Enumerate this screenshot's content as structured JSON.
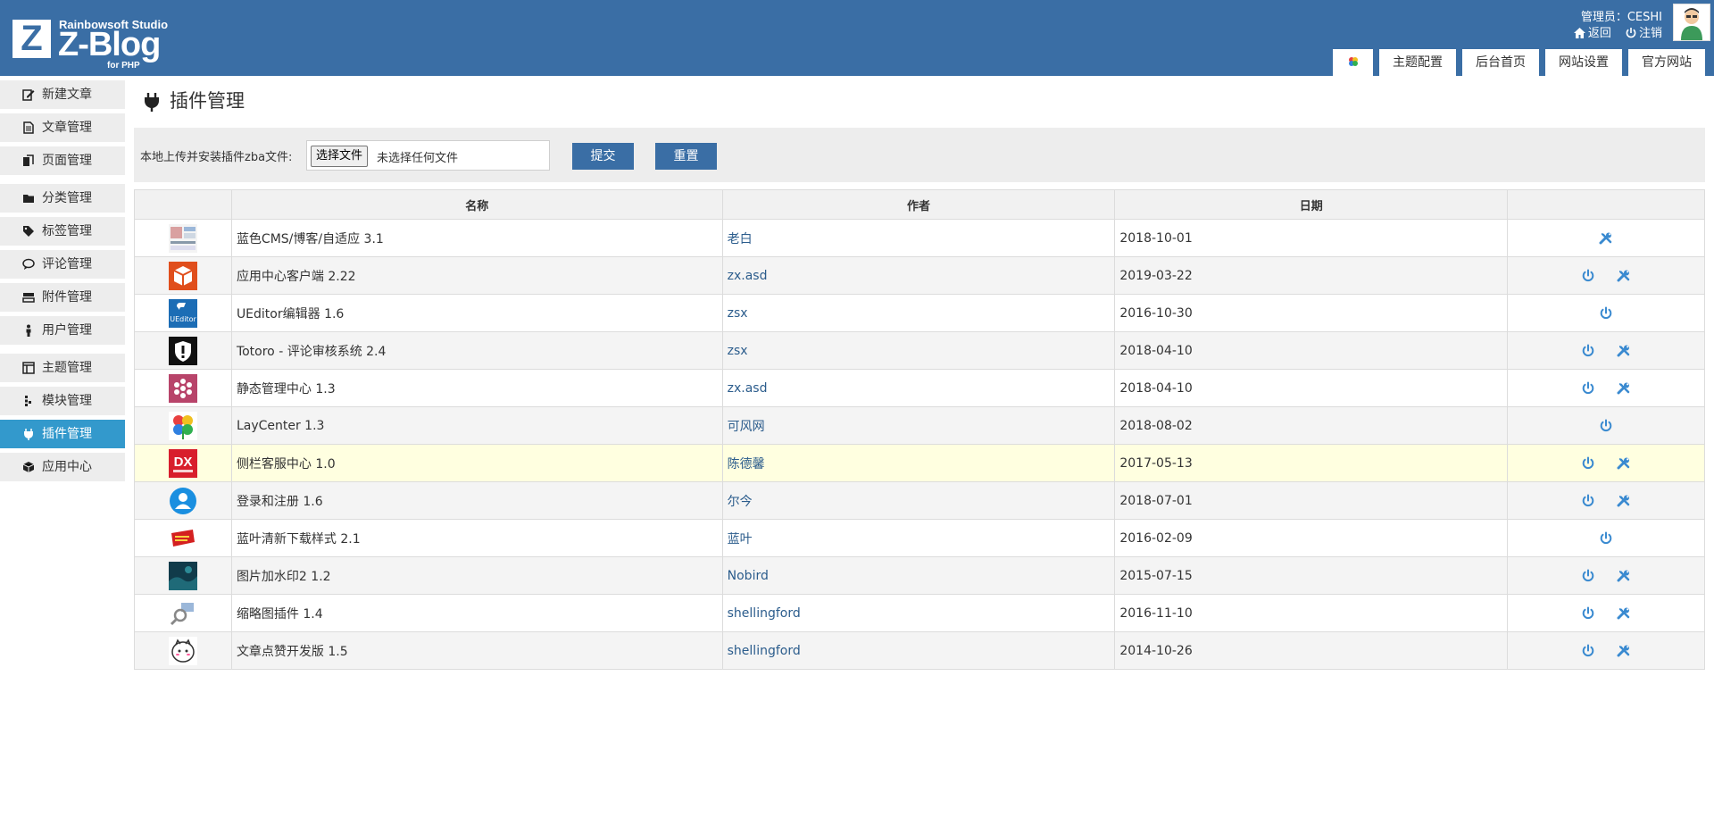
{
  "header": {
    "logo_box": "Z",
    "logo_studio": "Rainbowsoft Studio",
    "logo_name": "Z-Blog",
    "logo_sub": "for PHP",
    "admin_text": "管理员：CESHI",
    "back_label": "返回",
    "logout_label": "注销",
    "tabs": [
      "主题配置",
      "后台首页",
      "网站设置",
      "官方网站"
    ]
  },
  "sidebar": {
    "items": [
      {
        "label": "新建文章",
        "icon": "edit-icon"
      },
      {
        "label": "文章管理",
        "icon": "article-icon"
      },
      {
        "label": "页面管理",
        "icon": "page-icon"
      },
      {
        "label": "分类管理",
        "icon": "folder-icon"
      },
      {
        "label": "标签管理",
        "icon": "tag-icon"
      },
      {
        "label": "评论管理",
        "icon": "comment-icon"
      },
      {
        "label": "附件管理",
        "icon": "attachment-icon"
      },
      {
        "label": "用户管理",
        "icon": "user-icon"
      },
      {
        "label": "主题管理",
        "icon": "theme-icon"
      },
      {
        "label": "模块管理",
        "icon": "module-icon"
      },
      {
        "label": "插件管理",
        "icon": "plugin-icon"
      },
      {
        "label": "应用中心",
        "icon": "app-center-icon"
      }
    ]
  },
  "page": {
    "title": "插件管理",
    "upload_label": "本地上传并安装插件zba文件:",
    "file_button": "选择文件",
    "file_status": "未选择任何文件",
    "submit": "提交",
    "reset": "重置"
  },
  "table": {
    "headers": [
      "",
      "名称",
      "作者",
      "日期",
      ""
    ],
    "rows": [
      {
        "name": "蓝色CMS/博客/自适应 3.1",
        "author": "老白",
        "date": "2018-10-01",
        "actions": [
          "settings"
        ]
      },
      {
        "name": "应用中心客户端 2.22",
        "author": "zx.asd",
        "date": "2019-03-22",
        "actions": [
          "power",
          "settings"
        ]
      },
      {
        "name": "UEditor编辑器 1.6",
        "author": "zsx",
        "date": "2016-10-30",
        "actions": [
          "power"
        ]
      },
      {
        "name": "Totoro - 评论审核系统 2.4",
        "author": "zsx",
        "date": "2018-04-10",
        "actions": [
          "power",
          "settings"
        ]
      },
      {
        "name": "静态管理中心 1.3",
        "author": "zx.asd",
        "date": "2018-04-10",
        "actions": [
          "power",
          "settings"
        ]
      },
      {
        "name": "LayCenter 1.3",
        "author": "可风网",
        "date": "2018-08-02",
        "actions": [
          "power"
        ]
      },
      {
        "name": "侧栏客服中心 1.0",
        "author": "陈德馨",
        "date": "2017-05-13",
        "actions": [
          "power",
          "settings"
        ]
      },
      {
        "name": "登录和注册 1.6",
        "author": "尔今",
        "date": "2018-07-01",
        "actions": [
          "power",
          "settings"
        ]
      },
      {
        "name": "蓝叶清新下载样式 2.1",
        "author": "蓝叶",
        "date": "2016-02-09",
        "actions": [
          "power"
        ]
      },
      {
        "name": "图片加水印2 1.2",
        "author": "Nobird",
        "date": "2015-07-15",
        "actions": [
          "power",
          "settings"
        ]
      },
      {
        "name": "缩略图插件 1.4",
        "author": "shellingford",
        "date": "2016-11-10",
        "actions": [
          "power",
          "settings"
        ]
      },
      {
        "name": "文章点赞开发版 1.5",
        "author": "shellingford",
        "date": "2014-10-26",
        "actions": [
          "power",
          "settings"
        ]
      }
    ]
  },
  "icon_texts": {
    "ueditor": "UEditor",
    "dx": "DX"
  },
  "colors": {
    "header_bg": "#3a6ea5",
    "sidebar_active": "#3399cc",
    "link": "#2b5c8c",
    "action_icon": "#3a8ad0"
  }
}
